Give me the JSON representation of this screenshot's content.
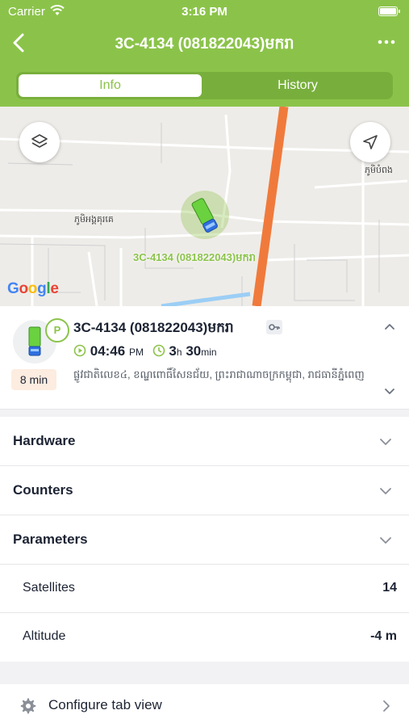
{
  "status_bar": {
    "carrier": "Carrier",
    "time": "3:16 PM"
  },
  "nav": {
    "title": "3C-4134 (081822043)មករា",
    "back_icon": "chevron-left-icon",
    "more_icon": "ellipsis-icon"
  },
  "tabs": [
    {
      "label": "Info",
      "selected": true
    },
    {
      "label": "History",
      "selected": false
    }
  ],
  "map": {
    "vehicle_label": "3C-4134 (081822043)មករា",
    "place_labels": [
      "ភូមិអង្គគុរគេ",
      "ភូមិបំពង"
    ],
    "provider": "Google"
  },
  "object": {
    "name": "3C-4134 (081822043)មករា",
    "status_badge": "P",
    "time_ago": "8 min",
    "clock_time": "04:46",
    "clock_period": "PM",
    "duration_hours": "3",
    "duration_h_unit": "h",
    "duration_minutes": "30",
    "duration_min_unit": "min",
    "address": "ផ្លូវជាតិលេខ៤, ខណ្ឌពោធិ៍សែនជ័យ, ព្រះរាជាណាចក្រកម្ពុជា, រាជធានីភ្នំពេញ"
  },
  "sections": [
    {
      "title": "Hardware"
    },
    {
      "title": "Counters"
    },
    {
      "title": "Parameters"
    }
  ],
  "parameters": [
    {
      "label": "Satellites",
      "value": "14"
    },
    {
      "label": "Altitude",
      "value": "-4 m"
    }
  ],
  "configure": {
    "label": "Configure tab view"
  },
  "colors": {
    "accent": "#8bc34a",
    "road_orange": "#f07a3b",
    "text": "#1c2333"
  }
}
